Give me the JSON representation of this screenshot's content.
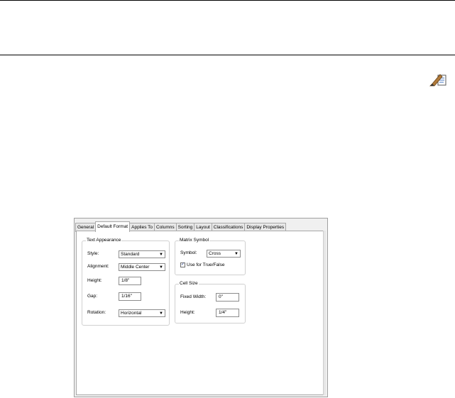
{
  "tabs": [
    {
      "label": "General"
    },
    {
      "label": "Default Format"
    },
    {
      "label": "Applies To"
    },
    {
      "label": "Columns"
    },
    {
      "label": "Sorting"
    },
    {
      "label": "Layout"
    },
    {
      "label": "Classifications"
    },
    {
      "label": "Display Properties"
    }
  ],
  "active_tab": "Default Format",
  "text_appearance": {
    "legend": "Text Appearance",
    "style_label": "Style:",
    "style_value": "Standard",
    "alignment_label": "Alignment:",
    "alignment_value": "Middle Center",
    "height_label": "Height:",
    "height_value": "1/8\"",
    "gap_label": "Gap:",
    "gap_value": "1/16\"",
    "rotation_label": "Rotation:",
    "rotation_value": "Horizontal"
  },
  "matrix_symbol": {
    "legend": "Matrix Symbol",
    "symbol_label": "Symbol:",
    "symbol_value": "Cross",
    "use_true_false_label": "Use for True/False",
    "use_true_false_checked": true
  },
  "cell_size": {
    "legend": "Cell Size",
    "fixed_width_label": "Fixed Width:",
    "fixed_width_value": "0\"",
    "height_label": "Height:",
    "height_value": "1/4\""
  },
  "icons": {
    "pencil": "edit-pencil-icon",
    "dropdown": "chevron-down-icon",
    "check": "checkmark-icon"
  }
}
